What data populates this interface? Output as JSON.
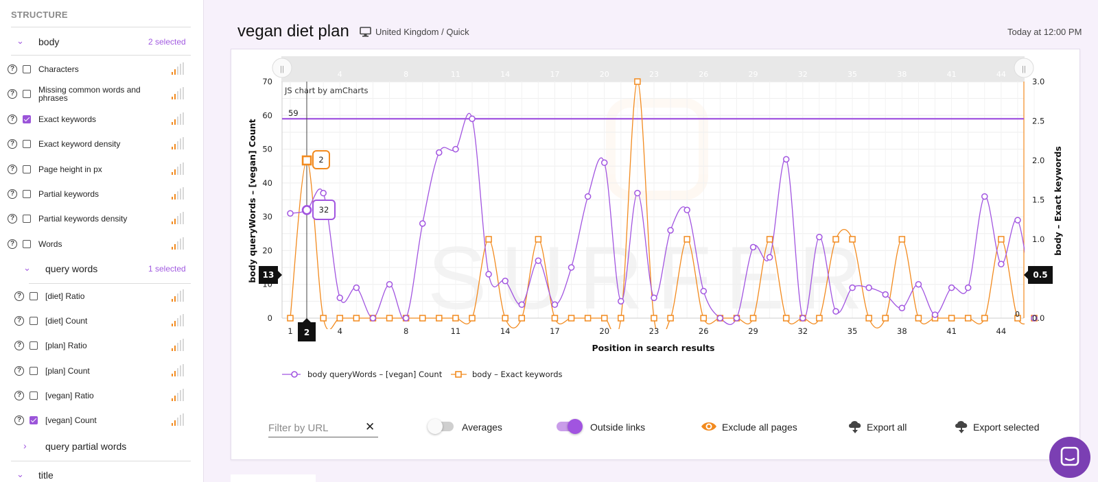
{
  "sidebar": {
    "section_title": "STRUCTURE",
    "group_body": {
      "label": "body",
      "count": "2 selected"
    },
    "body_items": [
      {
        "label": "Characters",
        "checked": false
      },
      {
        "label": "Missing common words and phrases",
        "checked": false
      },
      {
        "label": "Exact keywords",
        "checked": true
      },
      {
        "label": "Exact keyword density",
        "checked": false
      },
      {
        "label": "Page height in px",
        "checked": false
      },
      {
        "label": "Partial keywords",
        "checked": false
      },
      {
        "label": "Partial keywords density",
        "checked": false
      },
      {
        "label": "Words",
        "checked": false
      }
    ],
    "group_query_words": {
      "label": "query words",
      "count": "1 selected"
    },
    "query_items": [
      {
        "label": "[diet] Ratio",
        "checked": false
      },
      {
        "label": "[diet] Count",
        "checked": false
      },
      {
        "label": "[plan] Ratio",
        "checked": false
      },
      {
        "label": "[plan] Count",
        "checked": false
      },
      {
        "label": "[vegan] Ratio",
        "checked": false
      },
      {
        "label": "[vegan] Count",
        "checked": true
      }
    ],
    "group_query_partial": {
      "label": "query partial words"
    },
    "group_title": {
      "label": "title"
    },
    "help_glyph": "?"
  },
  "header": {
    "title": "vegan diet plan",
    "location": "United Kingdom / Quick",
    "timestamp": "Today at 12:00 PM"
  },
  "chart_data": {
    "type": "line",
    "credit": "JS chart by amCharts",
    "watermark": "SURFER",
    "xlabel": "Position in search results",
    "y_left_label": "body queryWords – [vegan] Count",
    "y_right_label": "body – Exact keywords",
    "x": [
      1,
      2,
      3,
      4,
      5,
      6,
      7,
      8,
      9,
      10,
      11,
      12,
      13,
      14,
      15,
      16,
      17,
      18,
      19,
      20,
      21,
      22,
      23,
      24,
      25,
      26,
      27,
      28,
      29,
      30,
      31,
      32,
      33,
      34,
      35,
      36,
      37,
      38,
      39,
      40,
      41,
      42,
      43,
      44,
      45,
      46
    ],
    "x_ticks": [
      1,
      4,
      8,
      11,
      14,
      17,
      20,
      23,
      26,
      29,
      32,
      35,
      38,
      41,
      44
    ],
    "scrollbar_ticks": [
      4,
      8,
      11,
      14,
      17,
      20,
      23,
      26,
      29,
      32,
      35,
      38,
      41,
      44
    ],
    "y_left_ticks": [
      0,
      10,
      20,
      30,
      40,
      50,
      60,
      70
    ],
    "y_right_ticks": [
      "0.0",
      "0.5",
      "1.0",
      "1.5",
      "2.0",
      "2.5",
      "3.0"
    ],
    "ylim_left": [
      0,
      70
    ],
    "ylim_right": [
      0,
      3
    ],
    "series": [
      {
        "name": "body queryWords – [vegan] Count",
        "axis": "left",
        "color": "#a154e0",
        "marker": "circle",
        "values": [
          31,
          32,
          37,
          6,
          9,
          0,
          10,
          0,
          28,
          49,
          50,
          59,
          13,
          11,
          4,
          17,
          4,
          15,
          36,
          46,
          5,
          37,
          6,
          26,
          32,
          8,
          0,
          0,
          21,
          18,
          47,
          0,
          24,
          2,
          9,
          9,
          7,
          3,
          10,
          1,
          9,
          9,
          36,
          16,
          29,
          0
        ]
      },
      {
        "name": "body – Exact keywords",
        "axis": "right",
        "color": "#f28a1e",
        "marker": "square",
        "values": [
          0,
          2,
          0,
          0,
          0,
          0,
          0,
          0,
          0,
          0,
          0,
          0,
          1,
          0,
          0,
          1,
          0,
          0,
          0,
          0,
          0,
          3,
          0,
          0,
          1,
          0,
          0,
          0,
          0,
          1,
          0,
          0,
          0,
          1,
          1,
          0,
          0,
          1,
          0,
          0,
          0,
          0,
          0,
          1,
          0,
          0
        ]
      }
    ],
    "average_line": {
      "value": 59,
      "label": "59"
    },
    "cursor": {
      "x_label": "2",
      "left_label": "13",
      "right_label": "0.5"
    },
    "tooltips": {
      "purple": "32",
      "orange": "2"
    },
    "end_label": "0",
    "scroll_grip": "||"
  },
  "controls": {
    "filter_placeholder": "Filter by URL",
    "clear_glyph": "✕",
    "averages": {
      "label": "Averages",
      "on": false
    },
    "outside_links": {
      "label": "Outside links",
      "on": true
    },
    "exclude_all": "Exclude all pages",
    "export_all": "Export all",
    "export_selected": "Export selected"
  },
  "colors": {
    "accent": "#a154e0",
    "orange": "#f28a1e",
    "chat": "#7b3fb3"
  }
}
